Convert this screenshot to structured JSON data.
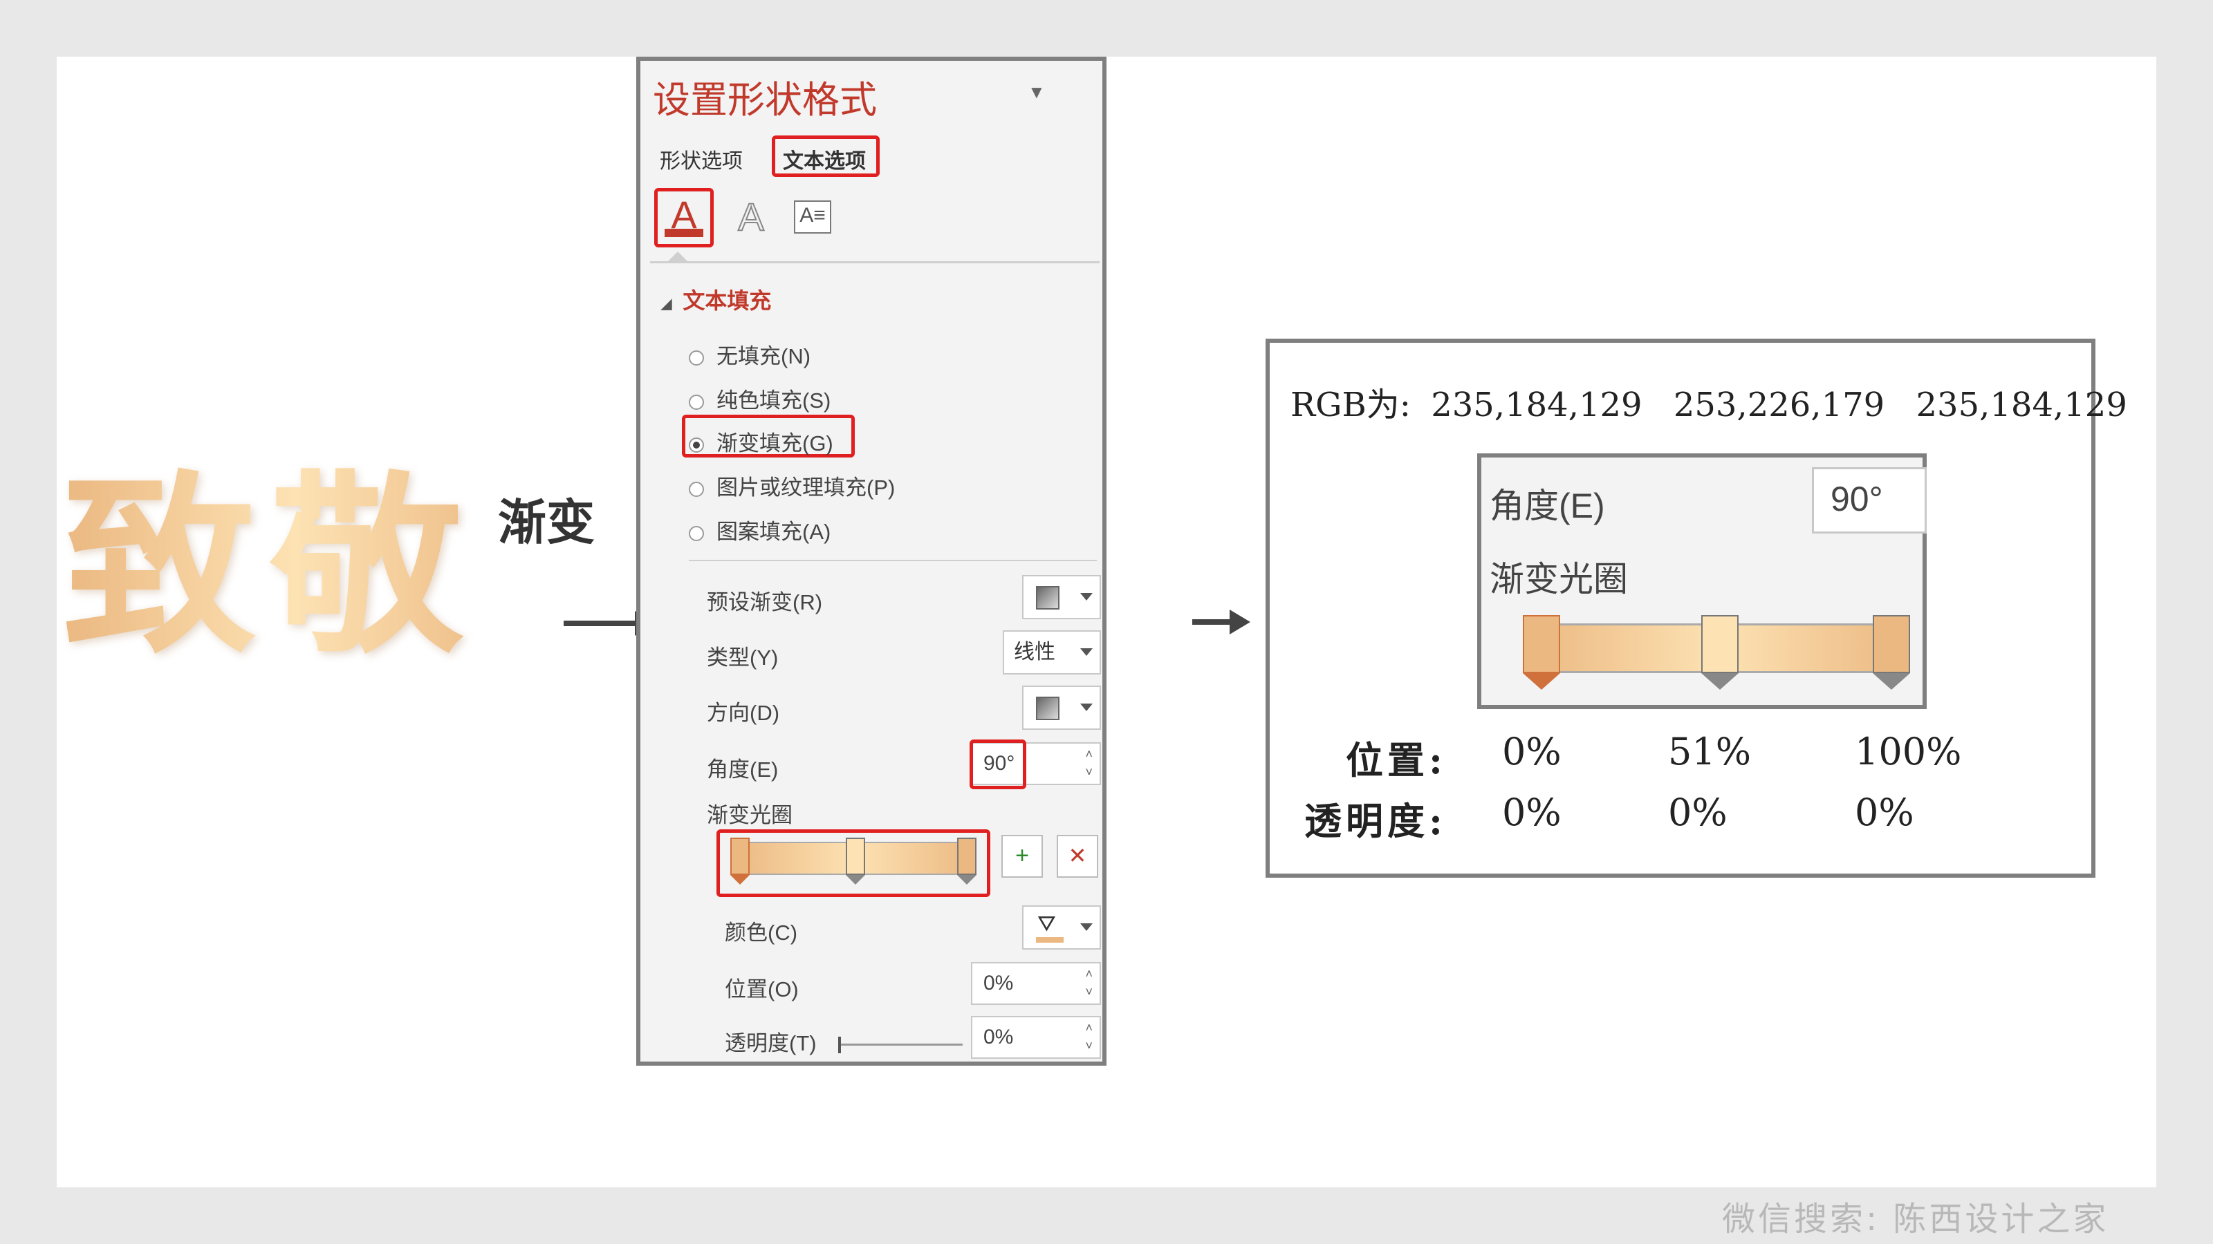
{
  "hero": {
    "text": "致敬"
  },
  "gradient_label": "渐变",
  "panel": {
    "title": "设置形状格式",
    "tabs": [
      "形状选项",
      "文本选项"
    ],
    "section": "文本填充",
    "fill_options": [
      "无填充(N)",
      "纯色填充(S)",
      "渐变填充(G)",
      "图片或纹理填充(P)",
      "图案填充(A)"
    ],
    "selected_fill": "渐变填充(G)",
    "preset_label": "预设渐变(R)",
    "type_label": "类型(Y)",
    "type_value": "线性",
    "direction_label": "方向(D)",
    "angle_label": "角度(E)",
    "angle_value": "90°",
    "stops_label": "渐变光圈",
    "color_label": "颜色(C)",
    "position_label": "位置(O)",
    "position_value": "0%",
    "transparency_label": "透明度(T)",
    "transparency_value": "0%"
  },
  "detail": {
    "rgb_prefix": "RGB为:",
    "rgb_values": [
      "235,184,129",
      "253,226,179",
      "235,184,129"
    ],
    "zoom_angle_label": "角度(E)",
    "zoom_angle_value": "90°",
    "zoom_stops_label": "渐变光圈",
    "position_row_label": "位置:",
    "positions": [
      "0%",
      "51%",
      "100%"
    ],
    "transparency_row_label": "透明度:",
    "transparencies": [
      "0%",
      "0%",
      "0%"
    ]
  },
  "gradient_stops": [
    {
      "position": 0,
      "color": "#ebb881"
    },
    {
      "position": 51,
      "color": "#fde2b3"
    },
    {
      "position": 100,
      "color": "#ebb881"
    }
  ],
  "colors": {
    "accent_red": "#e02020",
    "title_red": "#c0392b",
    "panel_bg": "#f3f3f3"
  },
  "watermark": "微信搜索: 陈西设计之家"
}
